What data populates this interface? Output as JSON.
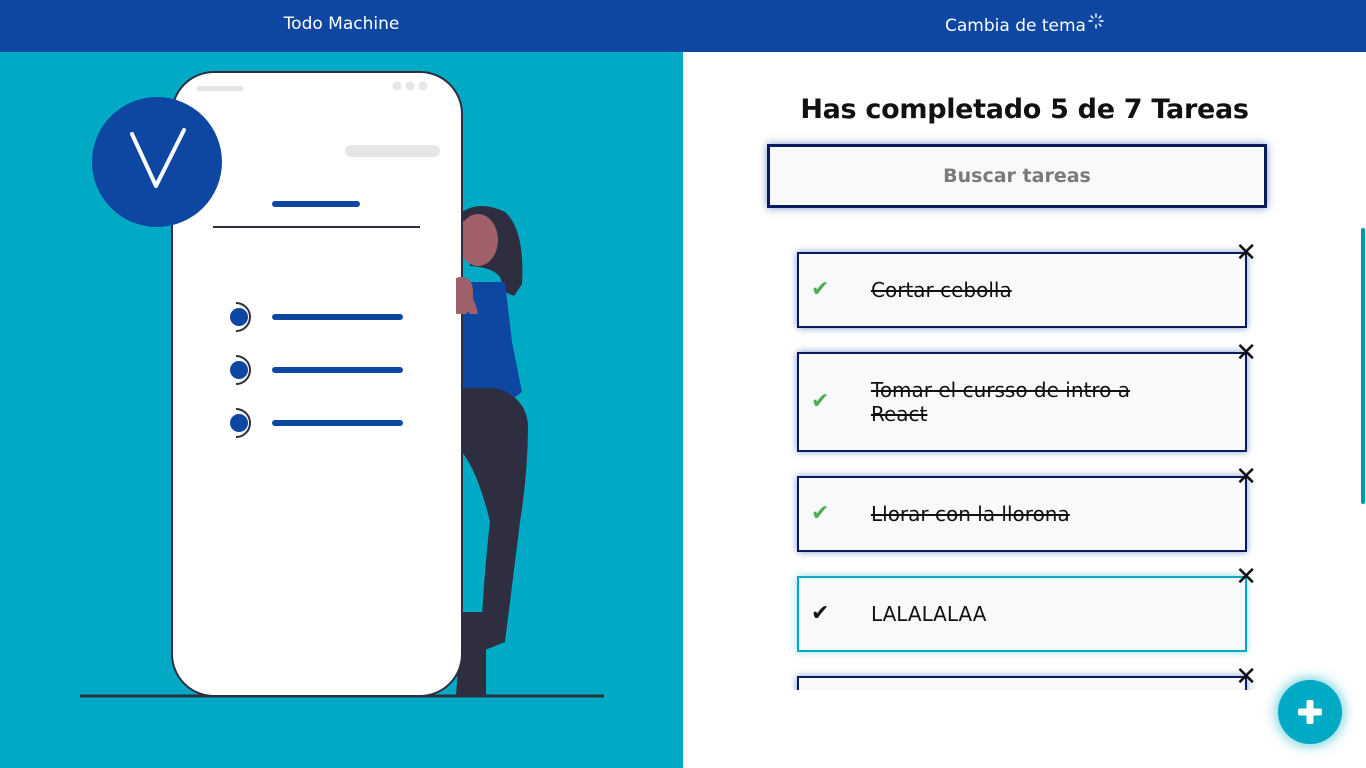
{
  "header": {
    "brand": "Todo Machine",
    "theme_label": "Cambia de tema",
    "theme_icon": "sparkle-icon"
  },
  "colors": {
    "primary": "#0d47a1",
    "accent": "#00aac4",
    "done": "#4caf50",
    "border": "#0a1a5c"
  },
  "counter": {
    "text": "Has completado 5 de 7 Tareas",
    "completed": 5,
    "total": 7
  },
  "search": {
    "placeholder": "Buscar tareas",
    "value": ""
  },
  "todos": [
    {
      "text": "Cortar cebolla",
      "completed": true
    },
    {
      "text": "Tomar el cursso de intro a React",
      "completed": true
    },
    {
      "text": "Llorar con la llorona",
      "completed": true
    },
    {
      "text": "LALALALAA",
      "completed": false
    },
    {
      "text": "",
      "completed": true
    }
  ],
  "icons": {
    "check": "✓",
    "check_done": "✔",
    "delete": "✕",
    "add": "+"
  }
}
